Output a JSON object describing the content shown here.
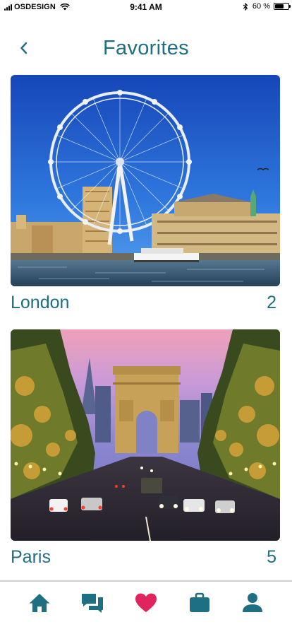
{
  "status_bar": {
    "carrier": "OSDESIGN",
    "time": "9:41 AM",
    "battery": "60 %",
    "battery_level": 0.6,
    "icons": [
      "signal-icon",
      "wifi-icon",
      "bluetooth-icon",
      "battery-icon"
    ]
  },
  "header": {
    "title": "Favorites",
    "back_icon": "chevron-left-icon"
  },
  "favorites": [
    {
      "name": "London",
      "count": "2",
      "image": "london-eye-photo"
    },
    {
      "name": "Paris",
      "count": "5",
      "image": "arc-de-triomphe-photo"
    }
  ],
  "tab_bar": {
    "items": [
      {
        "icon": "home-icon",
        "active": false
      },
      {
        "icon": "chat-icon",
        "active": false
      },
      {
        "icon": "heart-icon",
        "active": true
      },
      {
        "icon": "briefcase-icon",
        "active": false
      },
      {
        "icon": "user-icon",
        "active": false
      }
    ]
  },
  "colors": {
    "primary": "#1f6f82",
    "active_tab": "#e0245e",
    "divider": "#cfcfcf"
  }
}
